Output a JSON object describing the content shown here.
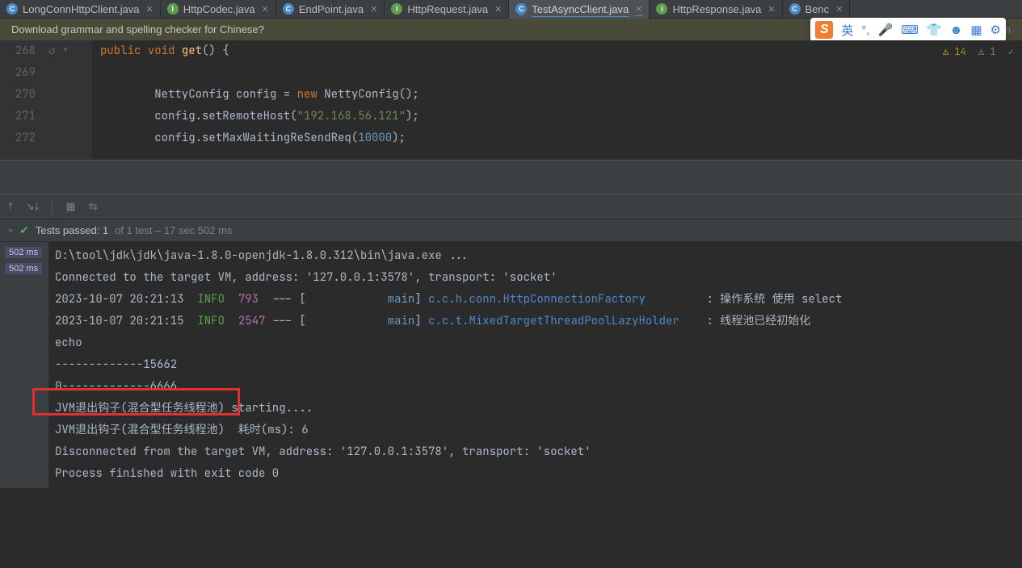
{
  "tabs": [
    {
      "icon": "C",
      "iconClass": "icon-c",
      "name": "LongConnHttpClient.java",
      "active": false
    },
    {
      "icon": "I",
      "iconClass": "icon-i",
      "name": "HttpCodec.java",
      "active": false
    },
    {
      "icon": "C",
      "iconClass": "icon-c",
      "name": "EndPoint.java",
      "active": false
    },
    {
      "icon": "I",
      "iconClass": "icon-i",
      "name": "HttpRequest.java",
      "active": false
    },
    {
      "icon": "C",
      "iconClass": "icon-c",
      "name": "TestAsyncClient.java",
      "active": true
    },
    {
      "icon": "I",
      "iconClass": "icon-i",
      "name": "HttpResponse.java",
      "active": false
    },
    {
      "icon": "C",
      "iconClass": "icon-c",
      "name": "Benc",
      "active": false
    }
  ],
  "banner": {
    "text": "Download grammar and spelling checker for Chinese?",
    "suffix": "Chin"
  },
  "warnings": {
    "warn_count": "14",
    "weak_count": "1"
  },
  "gutter": [
    "268",
    "269",
    "270",
    "271",
    "272"
  ],
  "code": {
    "l0": {
      "kw": "public void ",
      "fn": "get",
      "tail": "() {"
    },
    "l1": "",
    "l2": {
      "a": "NettyConfig config = ",
      "kw": "new ",
      "b": "NettyConfig();"
    },
    "l3": {
      "a": "config.setRemoteHost(",
      "str": "\"192.168.56.121\"",
      "b": ");"
    },
    "l4": {
      "a": "config.setMaxWaitingReSendReq(",
      "num": "10000",
      "b": ");"
    }
  },
  "ime_lang": "英",
  "test_status": {
    "prefix": "Tests passed: 1",
    "suffix": " of 1 test – 17 sec 502 ms"
  },
  "time_badges": [
    "502 ms",
    "502 ms"
  ],
  "console": [
    {
      "t": "plain",
      "text": "D:\\tool\\jdk\\jdk\\java-1.8.0-openjdk-1.8.0.312\\bin\\java.exe ..."
    },
    {
      "t": "plain",
      "text": "Connected to the target VM, address: '127.0.0.1:3578', transport: 'socket'"
    },
    {
      "t": "log",
      "ts": "2023-10-07 20:21:13",
      "lvl": "INFO",
      "pid": "793",
      "thread": "main",
      "logger": "c.c.h.conn.HttpConnectionFactory",
      "msg": "操作系统 使用 select"
    },
    {
      "t": "log",
      "ts": "2023-10-07 20:21:15",
      "lvl": "INFO",
      "pid": "2547",
      "thread": "main",
      "logger": "c.c.t.MixedTargetThreadPoolLazyHolder",
      "msg": "线程池已经初始化"
    },
    {
      "t": "plain",
      "text": "echo"
    },
    {
      "t": "plain",
      "text": ""
    },
    {
      "t": "plain",
      "text": "-------------15662"
    },
    {
      "t": "plain",
      "text": "0-------------6666"
    },
    {
      "t": "plain",
      "text": "JVM退出钩子(混合型任务线程池) starting...."
    },
    {
      "t": "plain",
      "text": "JVM退出钩子(混合型任务线程池)  耗时(ms): 6"
    },
    {
      "t": "plain",
      "text": "Disconnected from the target VM, address: '127.0.0.1:3578', transport: 'socket'"
    },
    {
      "t": "plain",
      "text": ""
    },
    {
      "t": "plain",
      "text": "Process finished with exit code 0"
    }
  ]
}
